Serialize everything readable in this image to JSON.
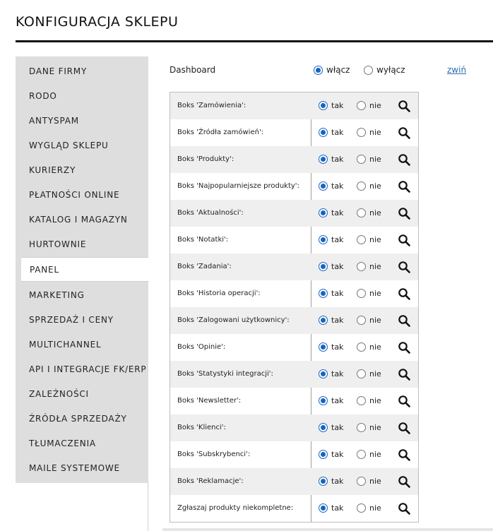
{
  "header": {
    "title": "KONFIGURACJA SKLEPU"
  },
  "sidebar": {
    "items": [
      {
        "label": "DANE FIRMY",
        "active": false
      },
      {
        "label": "RODO",
        "active": false
      },
      {
        "label": "ANTYSPAM",
        "active": false
      },
      {
        "label": "WYGLĄD SKLEPU",
        "active": false
      },
      {
        "label": "KURIERZY",
        "active": false
      },
      {
        "label": "PŁATNOŚCI ONLINE",
        "active": false
      },
      {
        "label": "KATALOG I MAGAZYN",
        "active": false
      },
      {
        "label": "HURTOWNIE",
        "active": false
      },
      {
        "label": "PANEL",
        "active": true
      },
      {
        "label": "MARKETING",
        "active": false
      },
      {
        "label": "SPRZEDAŻ I CENY",
        "active": false
      },
      {
        "label": "MULTICHANNEL",
        "active": false
      },
      {
        "label": "API I INTEGRACJE FK/ERP",
        "active": false
      },
      {
        "label": "ZALEŻNOŚCI",
        "active": false
      },
      {
        "label": "ŹRÓDŁA SPRZEDAŻY",
        "active": false
      },
      {
        "label": "TŁUMACZENIA",
        "active": false
      },
      {
        "label": "MAILE SYSTEMOWE",
        "active": false
      }
    ]
  },
  "dashboard": {
    "label": "Dashboard",
    "on_label": "włącz",
    "off_label": "wyłącz",
    "value": "on",
    "collapse_label": "zwiń"
  },
  "options": {
    "yes_label": "tak",
    "no_label": "nie"
  },
  "rows": [
    {
      "label": "Boks 'Zamówienia':",
      "value": "tak"
    },
    {
      "label": "Boks 'Źródła zamówień':",
      "value": "tak"
    },
    {
      "label": "Boks 'Produkty':",
      "value": "tak"
    },
    {
      "label": "Boks 'Najpopularniejsze produkty':",
      "value": "tak"
    },
    {
      "label": "Boks 'Aktualności':",
      "value": "tak"
    },
    {
      "label": "Boks 'Notatki':",
      "value": "tak"
    },
    {
      "label": "Boks 'Zadania':",
      "value": "tak"
    },
    {
      "label": "Boks 'Historia operacji':",
      "value": "tak"
    },
    {
      "label": "Boks 'Zalogowani użytkownicy':",
      "value": "tak"
    },
    {
      "label": "Boks 'Opinie':",
      "value": "tak"
    },
    {
      "label": "Boks 'Statystyki integracji':",
      "value": "tak"
    },
    {
      "label": "Boks 'Newsletter':",
      "value": "tak"
    },
    {
      "label": "Boks 'Klienci':",
      "value": "tak"
    },
    {
      "label": "Boks 'Subskrybenci':",
      "value": "tak"
    },
    {
      "label": "Boks 'Reklamacje':",
      "value": "tak"
    },
    {
      "label": "Zgłaszaj produkty niekompletne:",
      "value": "tak"
    }
  ],
  "icons": {
    "preview": "search-icon"
  },
  "colors": {
    "accent": "#1565c0",
    "link": "#2a6fb0",
    "sidebar_bg": "#dedede",
    "row_alt_bg": "#efefef"
  }
}
